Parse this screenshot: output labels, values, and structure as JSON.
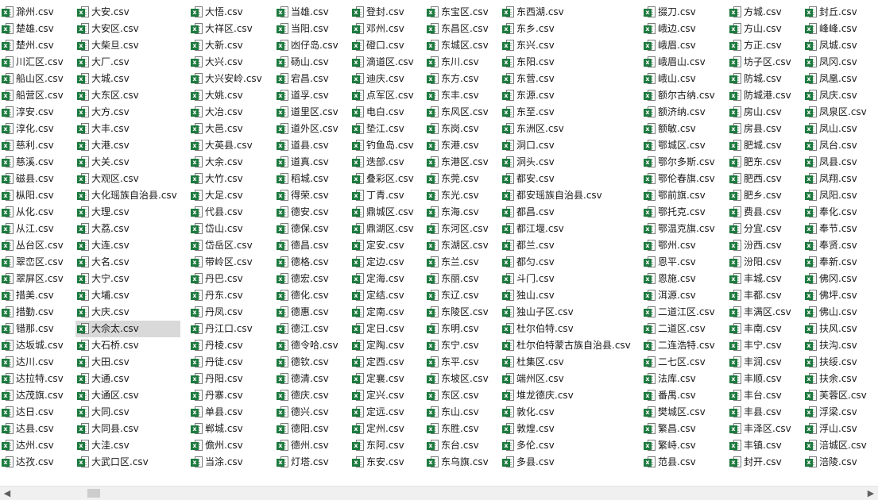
{
  "file_icon": "excel-csv-icon",
  "columns": [
    [
      "滁州.csv",
      "楚雄.csv",
      "楚州.csv",
      "川汇区.csv",
      "船山区.csv",
      "船营区.csv",
      "淳安.csv",
      "淳化.csv",
      "慈利.csv",
      "慈溪.csv",
      "磁县.csv",
      "枞阳.csv",
      "从化.csv",
      "从江.csv",
      "丛台区.csv",
      "翠峦区.csv",
      "翠屏区.csv",
      "措美.csv",
      "措勤.csv",
      "错那.csv",
      "达坂城.csv",
      "达川.csv",
      "达拉特.csv",
      "达茂旗.csv",
      "达日.csv",
      "达县.csv",
      "达州.csv",
      "达孜.csv"
    ],
    [
      "大安.csv",
      "大安区.csv",
      "大柴旦.csv",
      "大厂.csv",
      "大城.csv",
      "大东区.csv",
      "大方.csv",
      "大丰.csv",
      "大港.csv",
      "大关.csv",
      "大观区.csv",
      "大化瑶族自治县.csv",
      "大理.csv",
      "大荔.csv",
      "大连.csv",
      "大名.csv",
      "大宁.csv",
      "大埔.csv",
      "大庆.csv",
      "大佘太.csv",
      "大石桥.csv",
      "大田.csv",
      "大通.csv",
      "大通区.csv",
      "大同.csv",
      "大同县.csv",
      "大洼.csv",
      "大武口区.csv"
    ],
    [
      "大悟.csv",
      "大祥区.csv",
      "大新.csv",
      "大兴.csv",
      "大兴安岭.csv",
      "大姚.csv",
      "大冶.csv",
      "大邑.csv",
      "大英县.csv",
      "大余.csv",
      "大竹.csv",
      "大足.csv",
      "代县.csv",
      "岱山.csv",
      "岱岳区.csv",
      "带岭区.csv",
      "丹巴.csv",
      "丹东.csv",
      "丹凤.csv",
      "丹江口.csv",
      "丹棱.csv",
      "丹徒.csv",
      "丹阳.csv",
      "丹寨.csv",
      "单县.csv",
      "郸城.csv",
      "儋州.csv",
      "当涂.csv"
    ],
    [
      "当雄.csv",
      "当阳.csv",
      "凼仔岛.csv",
      "砀山.csv",
      "宕昌.csv",
      "道孚.csv",
      "道里区.csv",
      "道外区.csv",
      "道县.csv",
      "道真.csv",
      "稻城.csv",
      "得荣.csv",
      "德安.csv",
      "德保.csv",
      "德昌.csv",
      "德格.csv",
      "德宏.csv",
      "德化.csv",
      "德惠.csv",
      "德江.csv",
      "德令哈.csv",
      "德钦.csv",
      "德清.csv",
      "德庆.csv",
      "德兴.csv",
      "德阳.csv",
      "德州.csv",
      "灯塔.csv"
    ],
    [
      "登封.csv",
      "邓州.csv",
      "磴口.csv",
      "滴道区.csv",
      "迪庆.csv",
      "点军区.csv",
      "电白.csv",
      "垫江.csv",
      "钓鱼岛.csv",
      "迭部.csv",
      "叠彩区.csv",
      "丁青.csv",
      "鼎城区.csv",
      "鼎湖区.csv",
      "定安.csv",
      "定边.csv",
      "定海.csv",
      "定结.csv",
      "定南.csv",
      "定日.csv",
      "定陶.csv",
      "定西.csv",
      "定襄.csv",
      "定兴.csv",
      "定远.csv",
      "定州.csv",
      "东阿.csv",
      "东安.csv"
    ],
    [
      "东宝区.csv",
      "东昌区.csv",
      "东城区.csv",
      "东川.csv",
      "东方.csv",
      "东丰.csv",
      "东风区.csv",
      "东岗.csv",
      "东港.csv",
      "东港区.csv",
      "东莞.csv",
      "东光.csv",
      "东海.csv",
      "东河区.csv",
      "东湖区.csv",
      "东兰.csv",
      "东丽.csv",
      "东辽.csv",
      "东陵区.csv",
      "东明.csv",
      "东宁.csv",
      "东平.csv",
      "东坡区.csv",
      "东区.csv",
      "东山.csv",
      "东胜.csv",
      "东台.csv",
      "东乌旗.csv"
    ],
    [
      "东西湖.csv",
      "东乡.csv",
      "东兴.csv",
      "东阳.csv",
      "东营.csv",
      "东源.csv",
      "东至.csv",
      "东洲区.csv",
      "洞口.csv",
      "洞头.csv",
      "都安.csv",
      "都安瑶族自治县.csv",
      "都昌.csv",
      "都江堰.csv",
      "都兰.csv",
      "都匀.csv",
      "斗门.csv",
      "独山.csv",
      "独山子区.csv",
      "杜尔伯特.csv",
      "杜尔伯特蒙古族自治县.csv",
      "杜集区.csv",
      "端州区.csv",
      "堆龙德庆.csv",
      "敦化.csv",
      "敦煌.csv",
      "多伦.csv",
      "多县.csv"
    ],
    [
      "掇刀.csv",
      "峨边.csv",
      "峨眉.csv",
      "峨眉山.csv",
      "峨山.csv",
      "额尔古纳.csv",
      "额济纳.csv",
      "额敏.csv",
      "鄂城区.csv",
      "鄂尔多斯.csv",
      "鄂伦春旗.csv",
      "鄂前旗.csv",
      "鄂托克.csv",
      "鄂温克旗.csv",
      "鄂州.csv",
      "恩平.csv",
      "恩施.csv",
      "洱源.csv",
      "二道江区.csv",
      "二道区.csv",
      "二连浩特.csv",
      "二七区.csv",
      "法库.csv",
      "番禺.csv",
      "樊城区.csv",
      "繁昌.csv",
      "繁峙.csv",
      "范县.csv"
    ],
    [
      "方城.csv",
      "方山.csv",
      "方正.csv",
      "坊子区.csv",
      "防城.csv",
      "防城港.csv",
      "房山.csv",
      "房县.csv",
      "肥城.csv",
      "肥东.csv",
      "肥西.csv",
      "肥乡.csv",
      "费县.csv",
      "分宜.csv",
      "汾西.csv",
      "汾阳.csv",
      "丰城.csv",
      "丰都.csv",
      "丰满区.csv",
      "丰南.csv",
      "丰宁.csv",
      "丰润.csv",
      "丰顺.csv",
      "丰台.csv",
      "丰县.csv",
      "丰泽区.csv",
      "丰镇.csv",
      "封开.csv"
    ],
    [
      "封丘.csv",
      "峰峰.csv",
      "凤城.csv",
      "凤冈.csv",
      "凤凰.csv",
      "凤庆.csv",
      "凤泉区.csv",
      "凤山.csv",
      "凤台.csv",
      "凤县.csv",
      "凤翔.csv",
      "凤阳.csv",
      "奉化.csv",
      "奉节.csv",
      "奉贤.csv",
      "奉新.csv",
      "佛冈.csv",
      "佛坪.csv",
      "佛山.csv",
      "扶风.csv",
      "扶沟.csv",
      "扶绥.csv",
      "扶余.csv",
      "芙蓉区.csv",
      "浮梁.csv",
      "浮山.csv",
      "涪城区.csv",
      "涪陵.csv"
    ]
  ],
  "selected": {
    "column": 1,
    "row": 19
  },
  "scrollbar": {
    "left_arrow": "◀",
    "right_arrow": "▶",
    "position": 0.1
  }
}
